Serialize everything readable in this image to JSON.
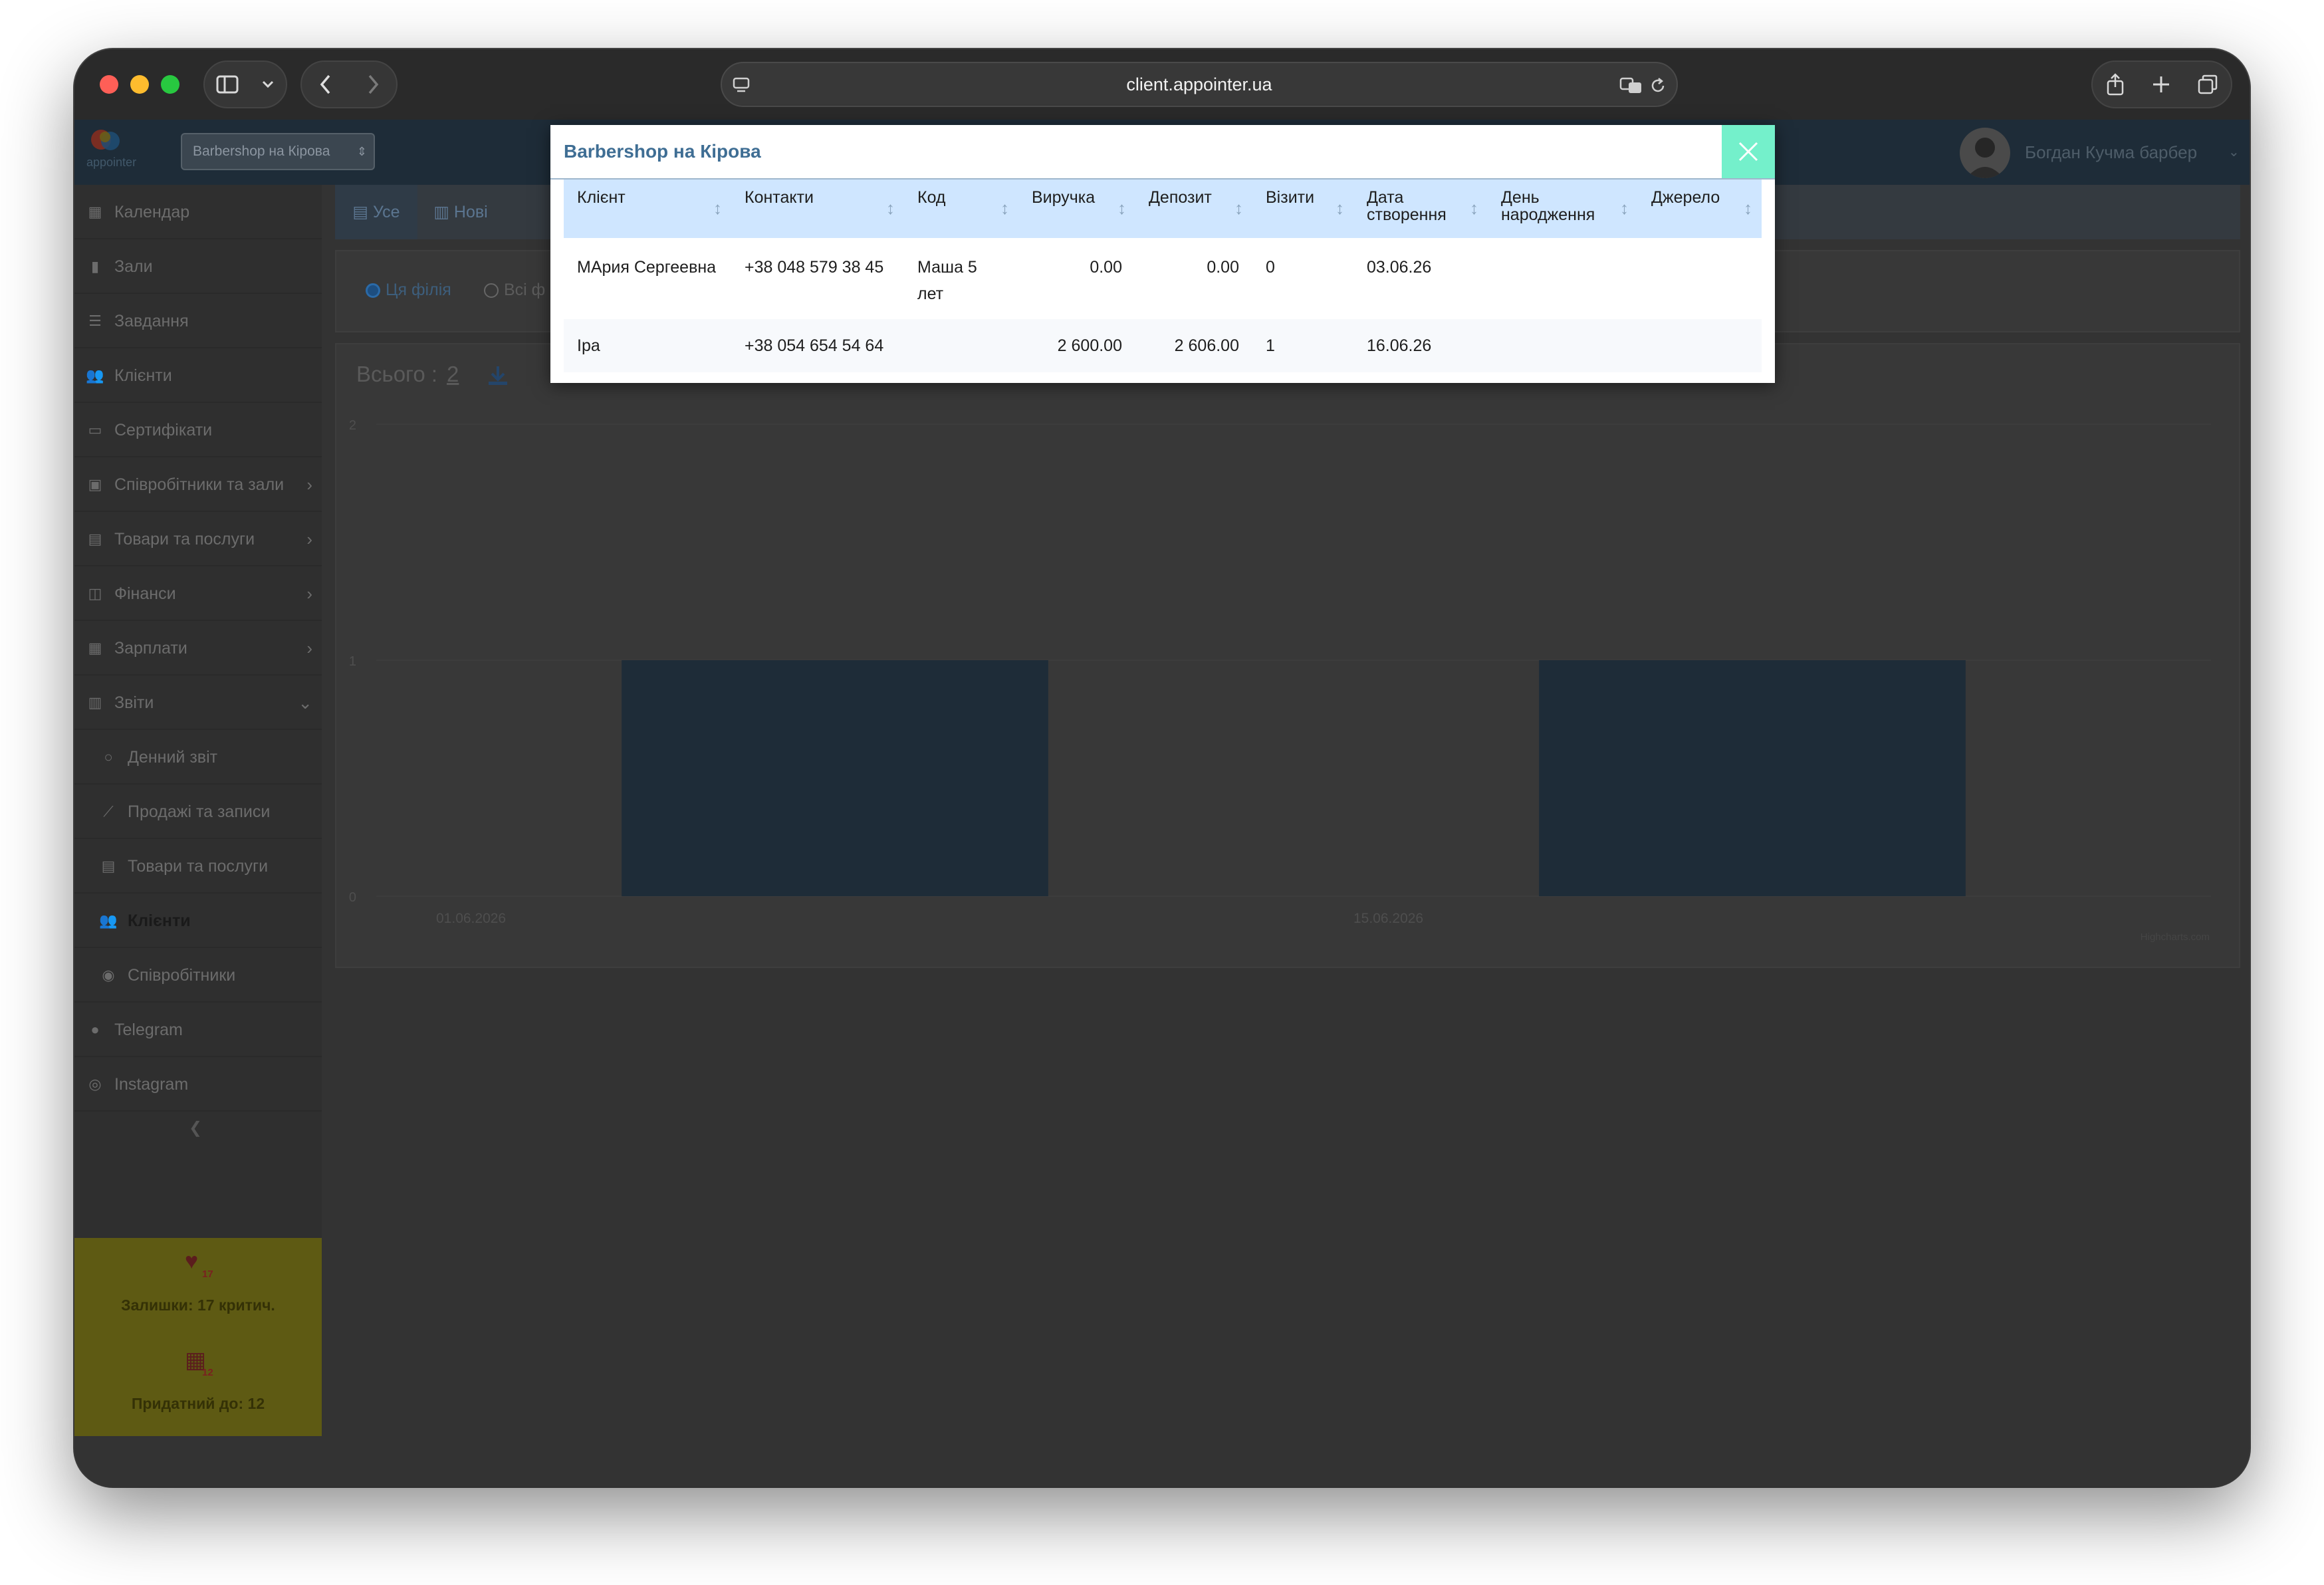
{
  "browser": {
    "url": "client.appointer.ua",
    "traffic_colors": {
      "close": "#fe5f57",
      "minimize": "#febc2e",
      "zoom": "#28c840"
    }
  },
  "app": {
    "logo_text": "appointer",
    "branch_select": "Barbershop на Кірова",
    "user_name": "Богдан Кучма барбер",
    "sidebar": {
      "items": [
        {
          "icon": "calendar-icon",
          "label": "Календар"
        },
        {
          "icon": "bookmark-icon",
          "label": "Зали"
        },
        {
          "icon": "tasks-icon",
          "label": "Завдання"
        },
        {
          "icon": "users-icon",
          "label": "Клієнти"
        },
        {
          "icon": "certificate-icon",
          "label": "Сертифікати"
        },
        {
          "icon": "staff-icon",
          "label": "Співробітники та зали"
        },
        {
          "icon": "goods-icon",
          "label": "Товари та послуги"
        },
        {
          "icon": "finance-icon",
          "label": "Фінанси"
        },
        {
          "icon": "salary-icon",
          "label": "Зарплати"
        },
        {
          "icon": "reports-icon",
          "label": "Звіти"
        },
        {
          "icon": "daily-report-icon",
          "label": "Денний звіт"
        },
        {
          "icon": "sales-chart-icon",
          "label": "Продажі та записи"
        },
        {
          "icon": "goods-report-icon",
          "label": "Товари та послуги"
        },
        {
          "icon": "clients-report-icon",
          "label": "Клієнти"
        },
        {
          "icon": "staff-report-icon",
          "label": "Співробітники"
        },
        {
          "icon": "telegram-icon",
          "label": "Telegram"
        },
        {
          "icon": "instagram-icon",
          "label": "Instagram"
        }
      ],
      "notice": {
        "stock": "Залишки: 17 критич.",
        "stock_badge": "17",
        "valid": "Придатний до: 12",
        "valid_badge": "12"
      }
    },
    "tabs": [
      "Усе",
      "Нові"
    ],
    "filter": {
      "this_branch": "Ця філія",
      "all_branches": "Всі ф"
    },
    "total": {
      "label": "Всього :",
      "value": "2"
    },
    "chart_data": {
      "type": "bar",
      "categories": [
        "01.06.2026",
        "15.06.2026"
      ],
      "values": [
        1,
        1
      ],
      "ylim": [
        0,
        2
      ],
      "yticks": [
        "0",
        "1",
        "2"
      ],
      "credit": "Highcharts.com"
    }
  },
  "modal": {
    "title": "Barbershop на Кірова",
    "columns": [
      "Клієнт",
      "Контакти",
      "Код",
      "Виручка",
      "Депозит",
      "Візити",
      "Дата створення",
      "День народження",
      "Джерело"
    ],
    "rows": [
      {
        "client": "МАрия Сергеевна",
        "contacts": "+38 048 579 38 45",
        "code": "Маша 5 лет",
        "revenue": "0.00",
        "deposit": "0.00",
        "visits": "0",
        "created": "03.06.26",
        "birthday": "",
        "source": ""
      },
      {
        "client": "Іра",
        "contacts": "+38 054 654 54 64",
        "code": "",
        "revenue": "2 600.00",
        "deposit": "2 606.00",
        "visits": "1",
        "created": "16.06.26",
        "birthday": "",
        "source": ""
      }
    ]
  }
}
